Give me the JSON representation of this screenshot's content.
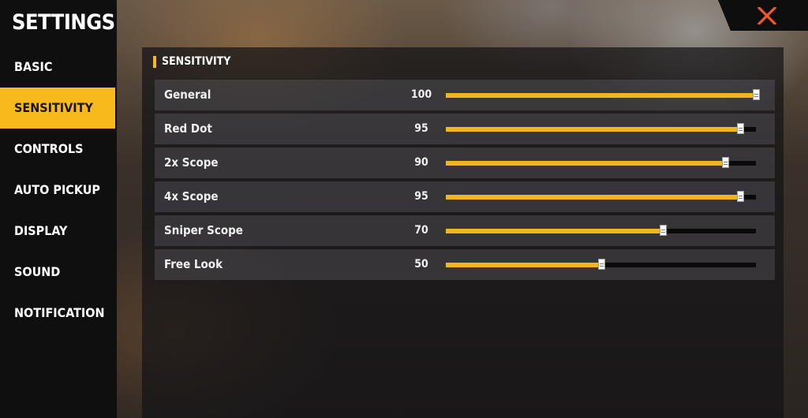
{
  "sidebar": {
    "title": "SETTINGS",
    "items": [
      {
        "label": "BASIC",
        "active": false
      },
      {
        "label": "SENSITIVITY",
        "active": true
      },
      {
        "label": "CONTROLS",
        "active": false
      },
      {
        "label": "AUTO PICKUP",
        "active": false
      },
      {
        "label": "DISPLAY",
        "active": false
      },
      {
        "label": "SOUND",
        "active": false
      },
      {
        "label": "NOTIFICATION",
        "active": false
      }
    ]
  },
  "close_button": {
    "icon": "close-icon",
    "color": "#f15a24"
  },
  "panel": {
    "title": "SENSITIVITY",
    "slider_max": 100,
    "rows": [
      {
        "label": "General",
        "value": 100
      },
      {
        "label": "Red Dot",
        "value": 95
      },
      {
        "label": "2x Scope",
        "value": 90
      },
      {
        "label": "4x Scope",
        "value": 95
      },
      {
        "label": "Sniper Scope",
        "value": 70
      },
      {
        "label": "Free Look",
        "value": 50
      }
    ]
  },
  "colors": {
    "accent": "#f7b91b",
    "slider_fill": "#f2b51d",
    "sidebar_bg": "#0f0f10"
  }
}
